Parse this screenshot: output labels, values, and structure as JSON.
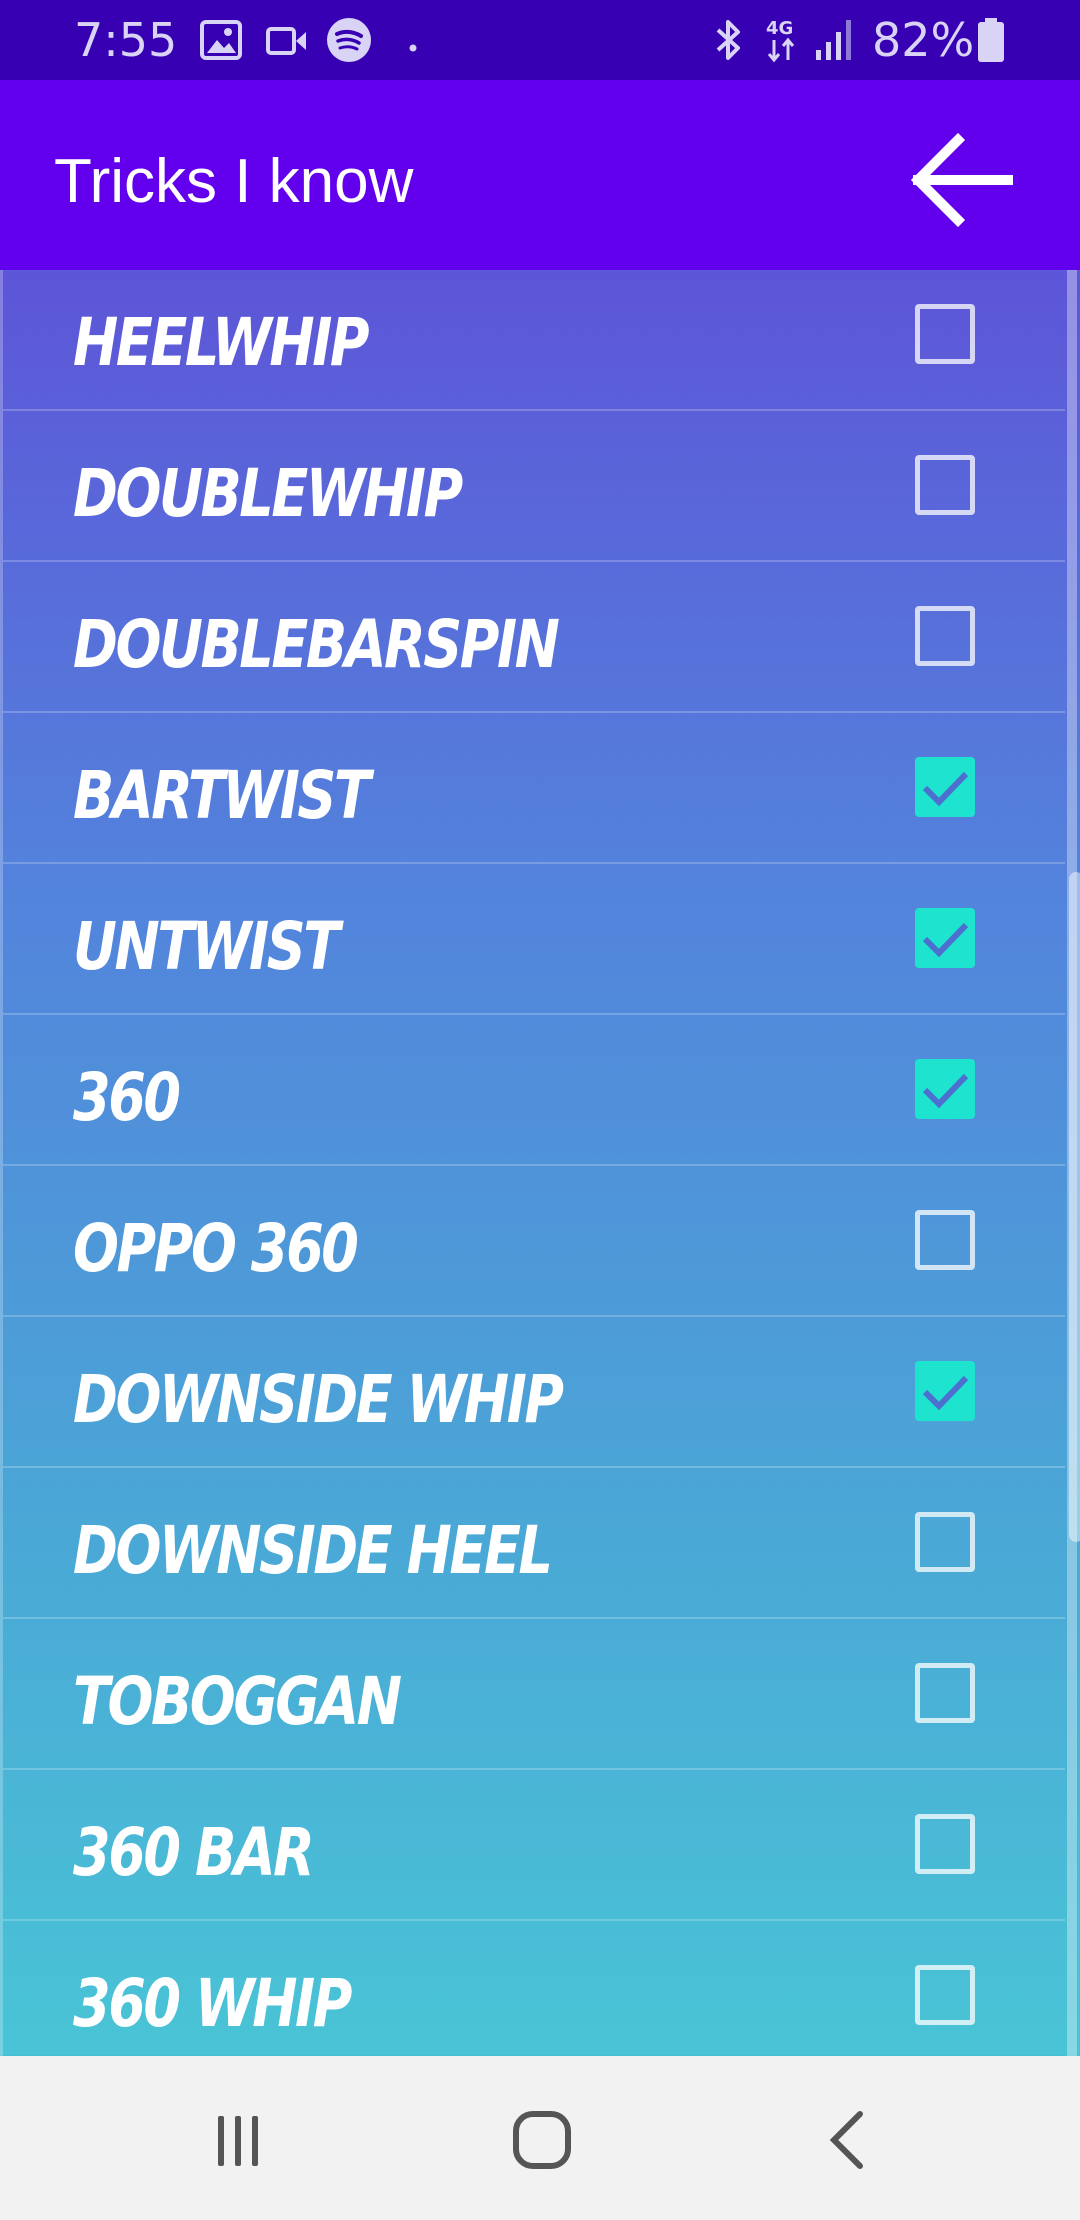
{
  "status_bar": {
    "time": "7:55",
    "battery": "82%",
    "icons": [
      "image-icon",
      "video-icon",
      "spotify-icon",
      "dot-icon",
      "bluetooth-icon",
      "4g-icon",
      "signal-icon",
      "battery-icon"
    ]
  },
  "app_bar": {
    "title": "Tricks I know",
    "back_icon": "arrow-left-icon"
  },
  "colors": {
    "status_bar": "#3700b3",
    "app_bar": "#6200ee",
    "gradient_top": "#5d55d8",
    "gradient_bottom": "#49c4d6",
    "checked": "#1ee3cf"
  },
  "tricks": [
    {
      "name": "HEELWHIP",
      "checked": false
    },
    {
      "name": "DOUBLEWHIP",
      "checked": false
    },
    {
      "name": "DOUBLEBARSPIN",
      "checked": false
    },
    {
      "name": "BARTWIST",
      "checked": true
    },
    {
      "name": "UNTWIST",
      "checked": true
    },
    {
      "name": "360",
      "checked": true
    },
    {
      "name": "OPPO 360",
      "checked": false
    },
    {
      "name": "DOWNSIDE WHIP",
      "checked": true
    },
    {
      "name": "DOWNSIDE HEEL",
      "checked": false
    },
    {
      "name": "TOBOGGAN",
      "checked": false
    },
    {
      "name": "360 BAR",
      "checked": false
    },
    {
      "name": "360 WHIP",
      "checked": false
    }
  ],
  "nav_bar": {
    "buttons": [
      "recents-icon",
      "home-icon",
      "back-icon"
    ]
  }
}
